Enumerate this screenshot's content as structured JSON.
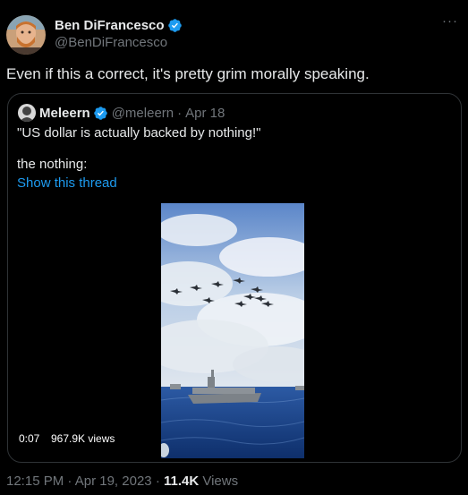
{
  "author": {
    "name": "Ben DiFrancesco",
    "handle": "@BenDiFrancesco",
    "verified_icon": "verified-badge-icon",
    "more_icon": "more-options-icon"
  },
  "tweet": {
    "text": "Even if this a correct, it's pretty grim morally speaking."
  },
  "quoted": {
    "name": "Meleern",
    "handle": "@meleern",
    "separator": "·",
    "date": "Apr 18",
    "text_line1": "\"US dollar is actually backed by nothing!\"",
    "text_line2": "the nothing:",
    "show_thread": "Show this thread",
    "video": {
      "time": "0:07",
      "views": "967.9K views"
    }
  },
  "footer": {
    "time": "12:15 PM",
    "separator1": "·",
    "date": "Apr 19, 2023",
    "separator2": "·",
    "views_count": "11.4K",
    "views_label": "Views"
  },
  "colors": {
    "background": "#000000",
    "text": "#e7e9ea",
    "secondary": "#71767b",
    "link": "#1d9bf0",
    "verified": "#1d9bf0",
    "border": "#2f3336"
  }
}
